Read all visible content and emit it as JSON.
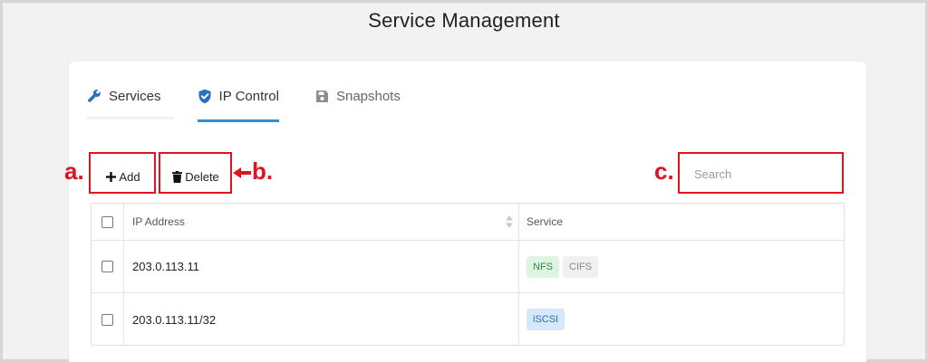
{
  "page": {
    "title": "Service Management"
  },
  "tabs": [
    {
      "label": "Services",
      "icon": "wrench-icon",
      "active": false
    },
    {
      "label": "IP Control",
      "icon": "shield-check-icon",
      "active": true
    },
    {
      "label": "Snapshots",
      "icon": "floppy-disk-icon",
      "active": false
    }
  ],
  "toolbar": {
    "add_label": "Add",
    "delete_label": "Delete",
    "search_placeholder": "Search"
  },
  "annotations": {
    "a": "a.",
    "b": "b.",
    "c": "c."
  },
  "table": {
    "columns": [
      "IP Address",
      "Service"
    ],
    "rows": [
      {
        "ip": "203.0.113.11",
        "services": [
          {
            "label": "NFS",
            "style": "green"
          },
          {
            "label": "CIFS",
            "style": "gray"
          }
        ]
      },
      {
        "ip": "203.0.113.11/32",
        "services": [
          {
            "label": "iSCSI",
            "style": "blue"
          }
        ]
      }
    ]
  },
  "colors": {
    "accent": "#2d8fd5",
    "annotation": "#e0141e",
    "tag_green_bg": "#dff3e3",
    "tag_blue_bg": "#d6e8fb"
  }
}
